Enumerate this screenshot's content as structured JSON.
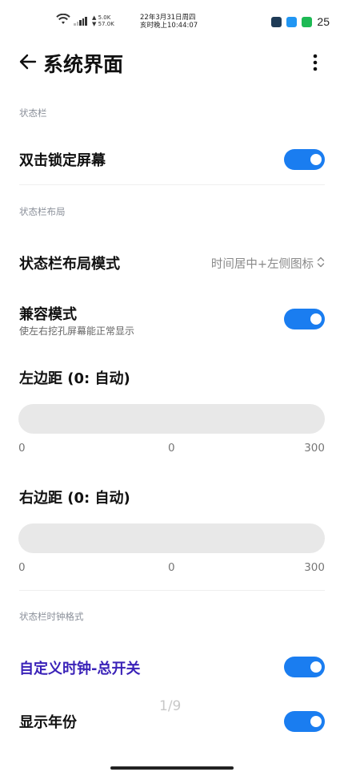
{
  "statusbar": {
    "net_up": "▲ 5.0K",
    "net_down": "▼ 57.0K",
    "date_line1": "22年3月31日周四",
    "date_line2": "亥时晚上10:44:07",
    "battery": "25"
  },
  "header": {
    "title": "系统界面"
  },
  "sections": {
    "statusbar": "状态栏",
    "layout": "状态栏布局",
    "clock_format": "状态栏时钟格式"
  },
  "rows": {
    "double_tap_lock": {
      "title": "双击锁定屏幕",
      "enabled": true
    },
    "layout_mode": {
      "title": "状态栏布局模式",
      "value": "时间居中+左侧图标"
    },
    "compat_mode": {
      "title": "兼容模式",
      "subtitle": "使左右挖孔屏幕能正常显示",
      "enabled": true
    },
    "left_margin": {
      "title": "左边距 (0: 自动)",
      "min": "0",
      "current": "0",
      "max": "300",
      "value": 0
    },
    "right_margin": {
      "title": "右边距 (0: 自动)",
      "min": "0",
      "current": "0",
      "max": "300",
      "value": 0
    },
    "custom_clock": {
      "title": "自定义时钟-总开关",
      "enabled": true
    },
    "show_year": {
      "title": "显示年份",
      "enabled": true
    }
  },
  "pager": "1/9",
  "colors": {
    "accent": "#1a7df0",
    "highlight_title": "#3a22b8"
  }
}
